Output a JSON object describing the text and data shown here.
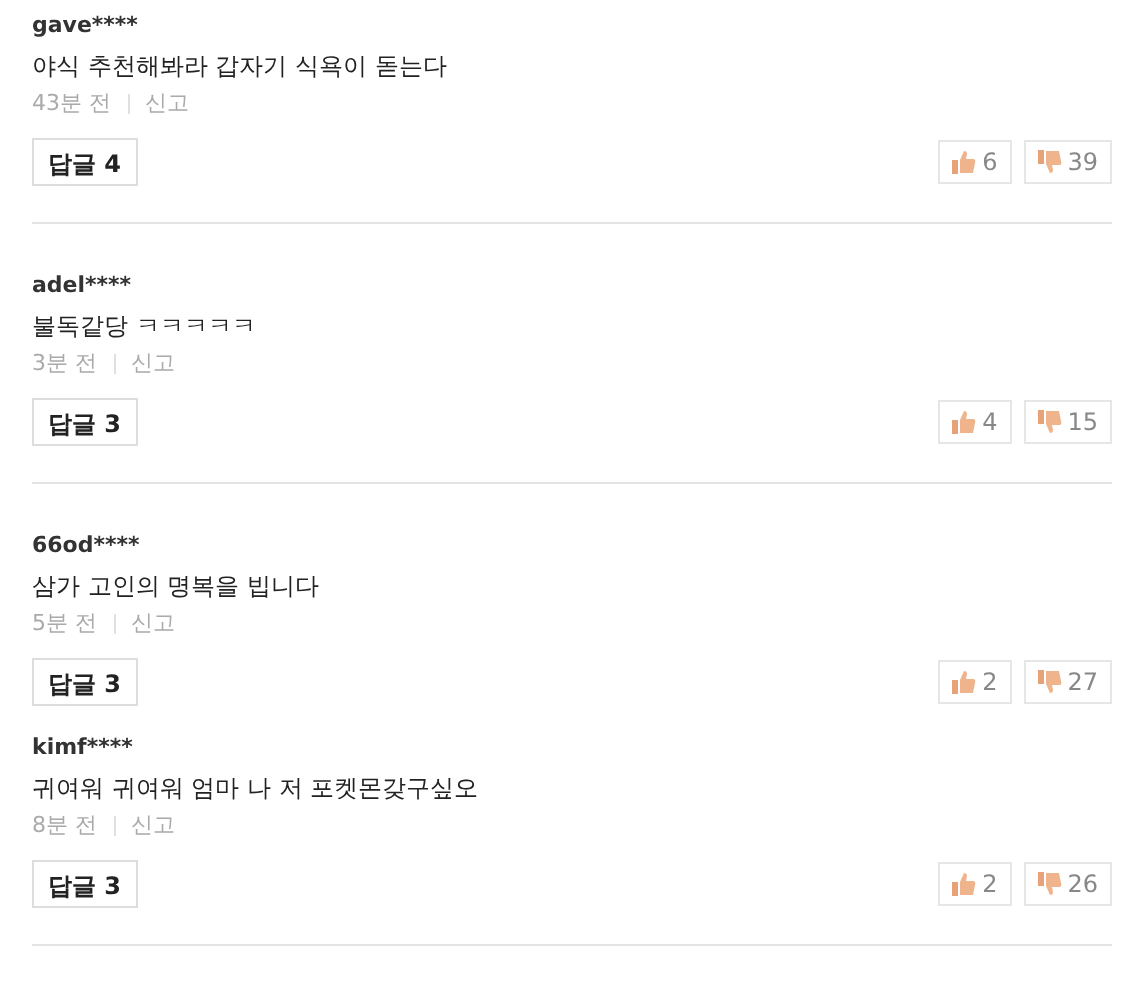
{
  "comments": [
    {
      "user": "gave****",
      "text": "야식 추천해봐라 갑자기 식욕이 돋는다",
      "time": "43분 전",
      "report": "신고",
      "reply": "답글 4",
      "likes": "6",
      "dislikes": "39",
      "separated": true
    },
    {
      "user": "adel****",
      "text": "불독같당 ㅋㅋㅋㅋㅋ",
      "time": "3분 전",
      "report": "신고",
      "reply": "답글 3",
      "likes": "4",
      "dislikes": "15",
      "separated": true
    },
    {
      "user": "66od****",
      "text": "삼가 고인의 명복을 빕니다",
      "time": "5분 전",
      "report": "신고",
      "reply": "답글 3",
      "likes": "2",
      "dislikes": "27",
      "separated": false
    },
    {
      "user": "kimf****",
      "text": "귀여워 귀여워 엄마 나 저 포켓몬갖구싶오",
      "time": "8분 전",
      "report": "신고",
      "reply": "답글 3",
      "likes": "2",
      "dislikes": "26",
      "separated": true
    }
  ]
}
